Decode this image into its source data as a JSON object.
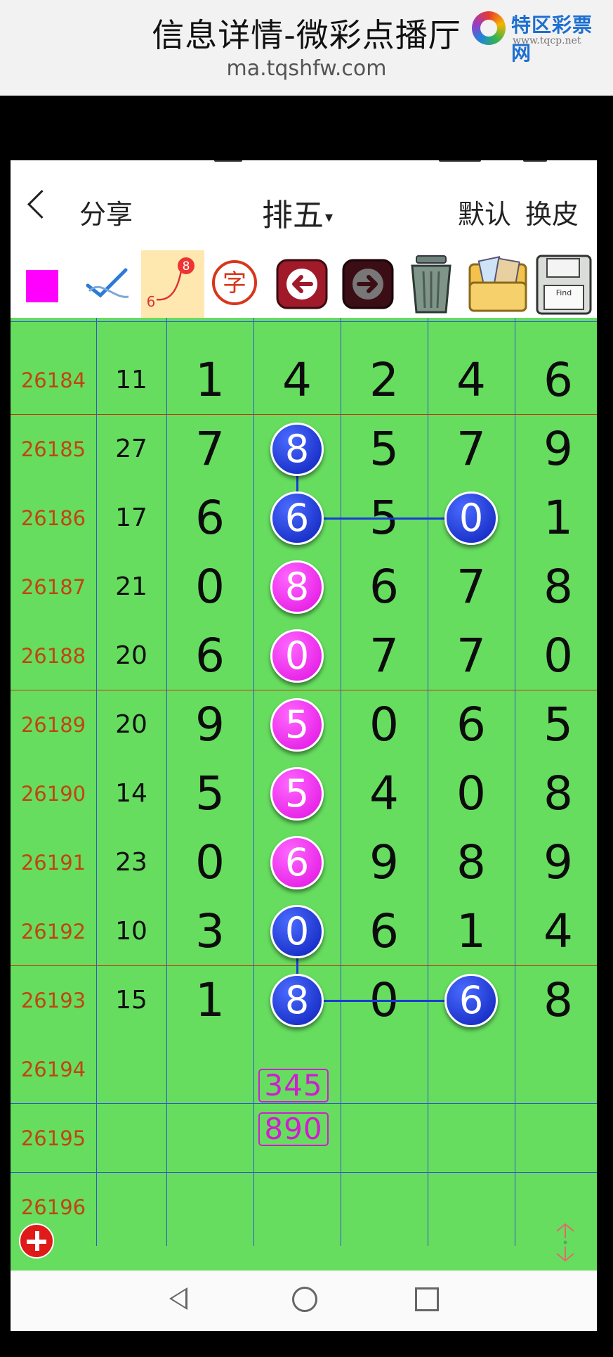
{
  "web_header": {
    "title": "信息详情-微彩点播厅",
    "url": "ma.tqshfw.com",
    "brand_name": "特区彩票网",
    "brand_site": "www.tqcp.net"
  },
  "appbar": {
    "share_label": "分享",
    "title": "排五",
    "caret": "▾",
    "default_label": "默认",
    "skin_label": "换皮"
  },
  "toolbar": {
    "items": [
      "magenta-swatch",
      "checkmark-pen-icon",
      "number-link-icon",
      "text-char-icon",
      "undo-arrow-icon",
      "redo-arrow-icon",
      "trash-icon",
      "folder-icon",
      "save-disk-icon"
    ],
    "link_icon_digits": [
      "8",
      "6"
    ],
    "text_icon_char": "字",
    "save_icon_label": "Find"
  },
  "colors": {
    "grid_bg": "#66dd5f",
    "issue_text": "#c0450f",
    "blue_ball": "#0b1fb8",
    "pink_ball": "#e010e0",
    "prediction": "#d21bd2"
  },
  "rows": [
    {
      "issue": "26184",
      "sum": "11",
      "digits": [
        "1",
        "4",
        "2",
        "4",
        "6"
      ]
    },
    {
      "issue": "26185",
      "sum": "27",
      "digits": [
        "7",
        "8",
        "5",
        "7",
        "9"
      ]
    },
    {
      "issue": "26186",
      "sum": "17",
      "digits": [
        "6",
        "6",
        "5",
        "0",
        "1"
      ]
    },
    {
      "issue": "26187",
      "sum": "21",
      "digits": [
        "0",
        "8",
        "6",
        "7",
        "8"
      ]
    },
    {
      "issue": "26188",
      "sum": "20",
      "digits": [
        "6",
        "0",
        "7",
        "7",
        "0"
      ]
    },
    {
      "issue": "26189",
      "sum": "20",
      "digits": [
        "9",
        "5",
        "0",
        "6",
        "5"
      ]
    },
    {
      "issue": "26190",
      "sum": "14",
      "digits": [
        "5",
        "5",
        "4",
        "0",
        "8"
      ]
    },
    {
      "issue": "26191",
      "sum": "23",
      "digits": [
        "0",
        "6",
        "9",
        "8",
        "9"
      ]
    },
    {
      "issue": "26192",
      "sum": "10",
      "digits": [
        "3",
        "0",
        "6",
        "1",
        "4"
      ]
    },
    {
      "issue": "26193",
      "sum": "15",
      "digits": [
        "1",
        "8",
        "0",
        "6",
        "8"
      ]
    },
    {
      "issue": "26194",
      "sum": "",
      "digits": [
        "",
        "",
        "",
        "",
        ""
      ]
    },
    {
      "issue": "26195",
      "sum": "",
      "digits": [
        "",
        "",
        "",
        "",
        ""
      ]
    },
    {
      "issue": "26196",
      "sum": "",
      "digits": [
        "",
        "",
        "",
        "",
        ""
      ]
    }
  ],
  "marks": [
    {
      "row": 1,
      "col": 1,
      "color": "blue"
    },
    {
      "row": 2,
      "col": 1,
      "color": "blue"
    },
    {
      "row": 2,
      "col": 3,
      "color": "blue"
    },
    {
      "row": 3,
      "col": 1,
      "color": "pink"
    },
    {
      "row": 4,
      "col": 1,
      "color": "pink"
    },
    {
      "row": 5,
      "col": 1,
      "color": "pink"
    },
    {
      "row": 6,
      "col": 1,
      "color": "pink"
    },
    {
      "row": 7,
      "col": 1,
      "color": "pink"
    },
    {
      "row": 8,
      "col": 1,
      "color": "blue"
    },
    {
      "row": 9,
      "col": 1,
      "color": "blue"
    },
    {
      "row": 9,
      "col": 3,
      "color": "blue"
    }
  ],
  "predictions": [
    "345",
    "890"
  ]
}
